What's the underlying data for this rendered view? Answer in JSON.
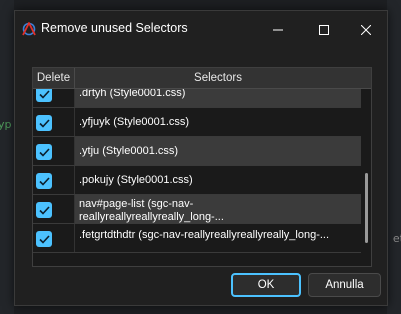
{
  "background": {
    "left_text": "yp",
    "right_text": "et"
  },
  "dialog": {
    "title": "Remove unused Selectors",
    "window_controls": {
      "minimize": "minimize-icon",
      "maximize": "maximize-icon",
      "close": "close-icon"
    }
  },
  "grid": {
    "columns": [
      "Delete",
      "Selectors"
    ],
    "rows": [
      {
        "checked": true,
        "lines": [
          ".drtyh (Style0001.css)"
        ]
      },
      {
        "checked": true,
        "lines": [
          ".yfjuyk (Style0001.css)"
        ]
      },
      {
        "checked": true,
        "lines": [
          ".ytju (Style0001.css)"
        ]
      },
      {
        "checked": true,
        "lines": [
          ".pokujy (Style0001.css)"
        ]
      },
      {
        "checked": true,
        "lines": [
          "nav#page-list (sgc-nav-",
          "reallyreallyreallyreally_long-..."
        ]
      },
      {
        "checked": true,
        "lines": [
          ".fetgrtdthdtr (sgc-nav-reallyreallyreallyreally_long-..."
        ]
      }
    ]
  },
  "buttons": {
    "ok": "OK",
    "cancel": "Annulla"
  },
  "colors": {
    "accent": "#4cc2ff",
    "dialog_bg": "#202020",
    "row_alt": "#3b3b3b",
    "header_bg": "#333333"
  }
}
